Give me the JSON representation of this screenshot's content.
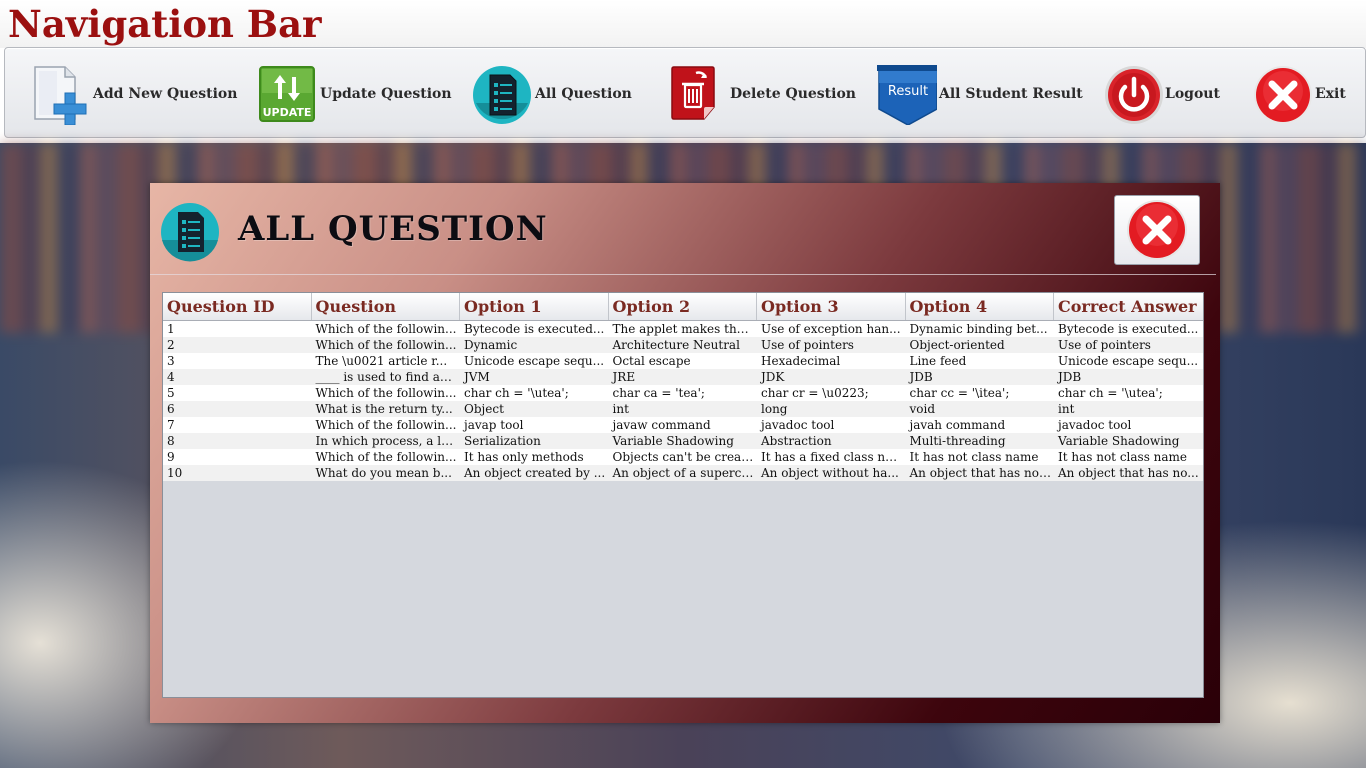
{
  "app": {
    "title": "Navigation Bar"
  },
  "toolbar": {
    "items": [
      {
        "label": "Add New Question",
        "icon": "add-document-icon"
      },
      {
        "label": "Update Question",
        "icon": "update-icon"
      },
      {
        "label": "All Question",
        "icon": "question-list-icon"
      },
      {
        "label": "Delete Question",
        "icon": "delete-trash-icon"
      },
      {
        "label": "All Student Result",
        "icon": "result-badge-icon"
      },
      {
        "label": "Logout",
        "icon": "power-icon"
      },
      {
        "label": "Exit",
        "icon": "close-circle-icon"
      }
    ],
    "update_badge": "UPDATE",
    "result_badge": "Result"
  },
  "panel": {
    "title": "ALL QUESTION",
    "close_icon": "close-circle-icon"
  },
  "table": {
    "columns": [
      "Question ID",
      "Question",
      "Option 1",
      "Option 2",
      "Option 3",
      "Option 4",
      "Correct Answer"
    ],
    "rows": [
      [
        "1",
        "Which of the followin...",
        "Bytecode is executed...",
        "The applet makes the...",
        "Use of exception han...",
        "Dynamic binding bet...",
        "Bytecode is executed..."
      ],
      [
        "2",
        "Which of the followin...",
        "Dynamic",
        "Architecture Neutral",
        "Use of pointers",
        "Object-oriented",
        "Use of pointers"
      ],
      [
        "3",
        "The \\u0021 article r...",
        "Unicode escape sequ...",
        "Octal escape",
        "Hexadecimal",
        "Line feed",
        "Unicode escape sequ..."
      ],
      [
        "4",
        "____ is used to find an...",
        "JVM",
        "JRE",
        "JDK",
        "JDB",
        "JDB"
      ],
      [
        "5",
        "Which of the followin...",
        "char ch = '\\utea';",
        "char ca = 'tea';",
        "char cr = \\u0223;",
        "char cc = '\\itea';",
        "char ch = '\\utea';"
      ],
      [
        "6",
        "What is the return ty...",
        "Object",
        "int",
        "long",
        "void",
        "int"
      ],
      [
        "7",
        "Which of the followin...",
        "javap tool",
        "javaw command",
        "javadoc tool",
        "javah command",
        "javadoc tool"
      ],
      [
        "8",
        "In which process, a lo...",
        "Serialization",
        "Variable Shadowing",
        "Abstraction",
        "Multi-threading",
        "Variable Shadowing"
      ],
      [
        "9",
        "Which of the followin...",
        "It has only methods",
        "Objects can't be creat...",
        "It has a fixed class na...",
        "It has not class name",
        "It has not class name"
      ],
      [
        "10",
        "What do you mean b...",
        "An object created by ...",
        "An object of a supercl...",
        "An object without ha...",
        "An object that has no ...",
        "An object that has no..."
      ]
    ]
  },
  "colors": {
    "title": "#9b1010",
    "header_text": "#7a2a22",
    "panel_dark": "#3d050d",
    "panel_light": "#e7b6a6"
  }
}
